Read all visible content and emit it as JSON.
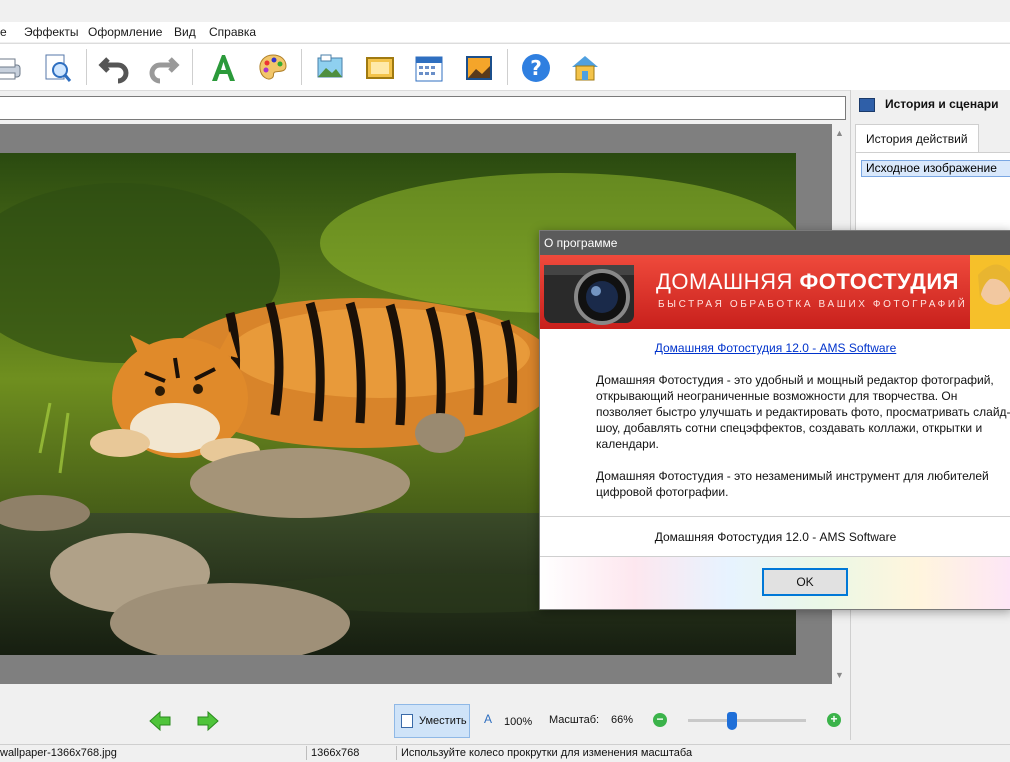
{
  "menu": [
    "е",
    "Эффекты",
    "Оформление",
    "Вид",
    "Справка"
  ],
  "panel": {
    "title": "История и сценари",
    "tab": "История действий",
    "history_item": "Исходное изображение"
  },
  "bottom": {
    "fit": "Уместить",
    "actual": "100%",
    "zoom_label": "Масштаб:",
    "zoom_value": "66%",
    "zoom_fraction": 0.37
  },
  "status": {
    "file": "wallpaper-1366x768.jpg",
    "dims": "1366x768",
    "hint": "Используйте колесо прокрутки для изменения масштаба"
  },
  "dialog": {
    "title": "О программе",
    "brand_light": "ДОМАШНЯЯ ",
    "brand_bold": "ФОТОСТУДИЯ",
    "brand_sub": "БЫСТРАЯ ОБРАБОТКА ВАШИХ ФОТОГРАФИЙ",
    "link": "Домашняя Фотостудия 12.0 - AMS Software",
    "para1": "Домашняя Фотостудия - это удобный и мощный редактор фотографий, открывающий неограниченные возможности для творчества. Он позволяет быстро улучшать и редактировать фото, просматривать слайд-шоу, добавлять сотни спецэффектов, создавать коллажи, открытки и календари.",
    "para2": "Домашняя Фотостудия - это незаменимый инструмент для любителей цифровой фотографии.",
    "footer": "Домашняя Фотостудия 12.0 - AMS Software",
    "ok": "OK"
  },
  "colors": {
    "accent": "#0078d7",
    "banner": "#e03a30",
    "link": "#0033cc"
  }
}
